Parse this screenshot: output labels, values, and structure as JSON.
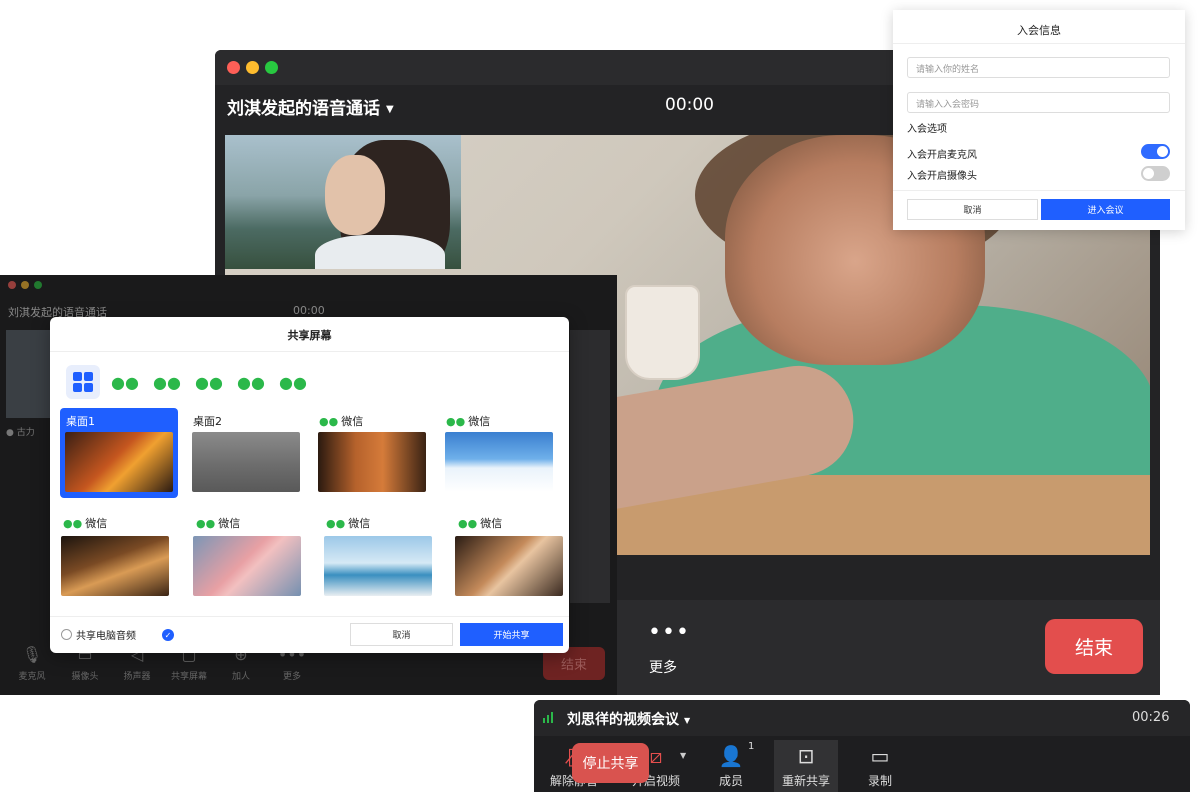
{
  "main_window": {
    "title": "刘淇发起的语音通话",
    "timer": "00:00",
    "more_icon": "•••",
    "more_label": "更多",
    "end_label": "结束"
  },
  "join_panel": {
    "title": "入会信息",
    "name_placeholder": "请输入你的姓名",
    "password_placeholder": "请输入入会密码",
    "options_label": "入会选项",
    "mic_label": "入会开启麦克风",
    "mic_on": true,
    "camera_label": "入会开启摄像头",
    "camera_on": false,
    "cancel_label": "取消",
    "enter_label": "进入会议"
  },
  "back_window": {
    "title": "刘淇发起的语音通话",
    "timer": "00:00",
    "user_label": "古力",
    "toolbar": [
      {
        "label": "麦克风",
        "icon": "mic-icon"
      },
      {
        "label": "摄像头",
        "icon": "camera-icon"
      },
      {
        "label": "扬声器",
        "icon": "speaker-icon"
      },
      {
        "label": "共享屏幕",
        "icon": "screen-icon"
      },
      {
        "label": "加人",
        "icon": "add-person-icon"
      },
      {
        "label": "更多",
        "icon": "more-icon"
      }
    ],
    "end_label": "结束"
  },
  "share_dialog": {
    "title": "共享屏幕",
    "tiles": [
      {
        "label": "桌面1",
        "type": "desktop",
        "selected": true
      },
      {
        "label": "桌面2",
        "type": "desktop",
        "selected": false
      },
      {
        "label": "微信",
        "type": "wechat",
        "selected": false
      },
      {
        "label": "微信",
        "type": "wechat",
        "selected": false
      },
      {
        "label": "微信",
        "type": "wechat",
        "selected": false
      },
      {
        "label": "微信",
        "type": "wechat",
        "selected": false
      },
      {
        "label": "微信",
        "type": "wechat",
        "selected": false
      },
      {
        "label": "微信",
        "type": "wechat",
        "selected": false
      }
    ],
    "audio_label": "共享电脑音频",
    "cancel_label": "取消",
    "start_label": "开始共享"
  },
  "meeting_bar": {
    "title": "刘思徉的视频会议",
    "timer": "00:26",
    "member_count": "1",
    "tools": [
      {
        "label": "解除静音",
        "icon": "mic-muted-icon"
      },
      {
        "label": "开启视频",
        "icon": "video-off-icon"
      },
      {
        "label": "成员",
        "icon": "person-icon"
      },
      {
        "label": "重新共享",
        "icon": "share-screen-icon"
      },
      {
        "label": "录制",
        "icon": "record-icon"
      }
    ],
    "stop_share_label": "停止共享"
  },
  "colors": {
    "accent_blue": "#1f5fff",
    "end_red": "#e34e4d",
    "wechat_green": "#2bb84a"
  }
}
